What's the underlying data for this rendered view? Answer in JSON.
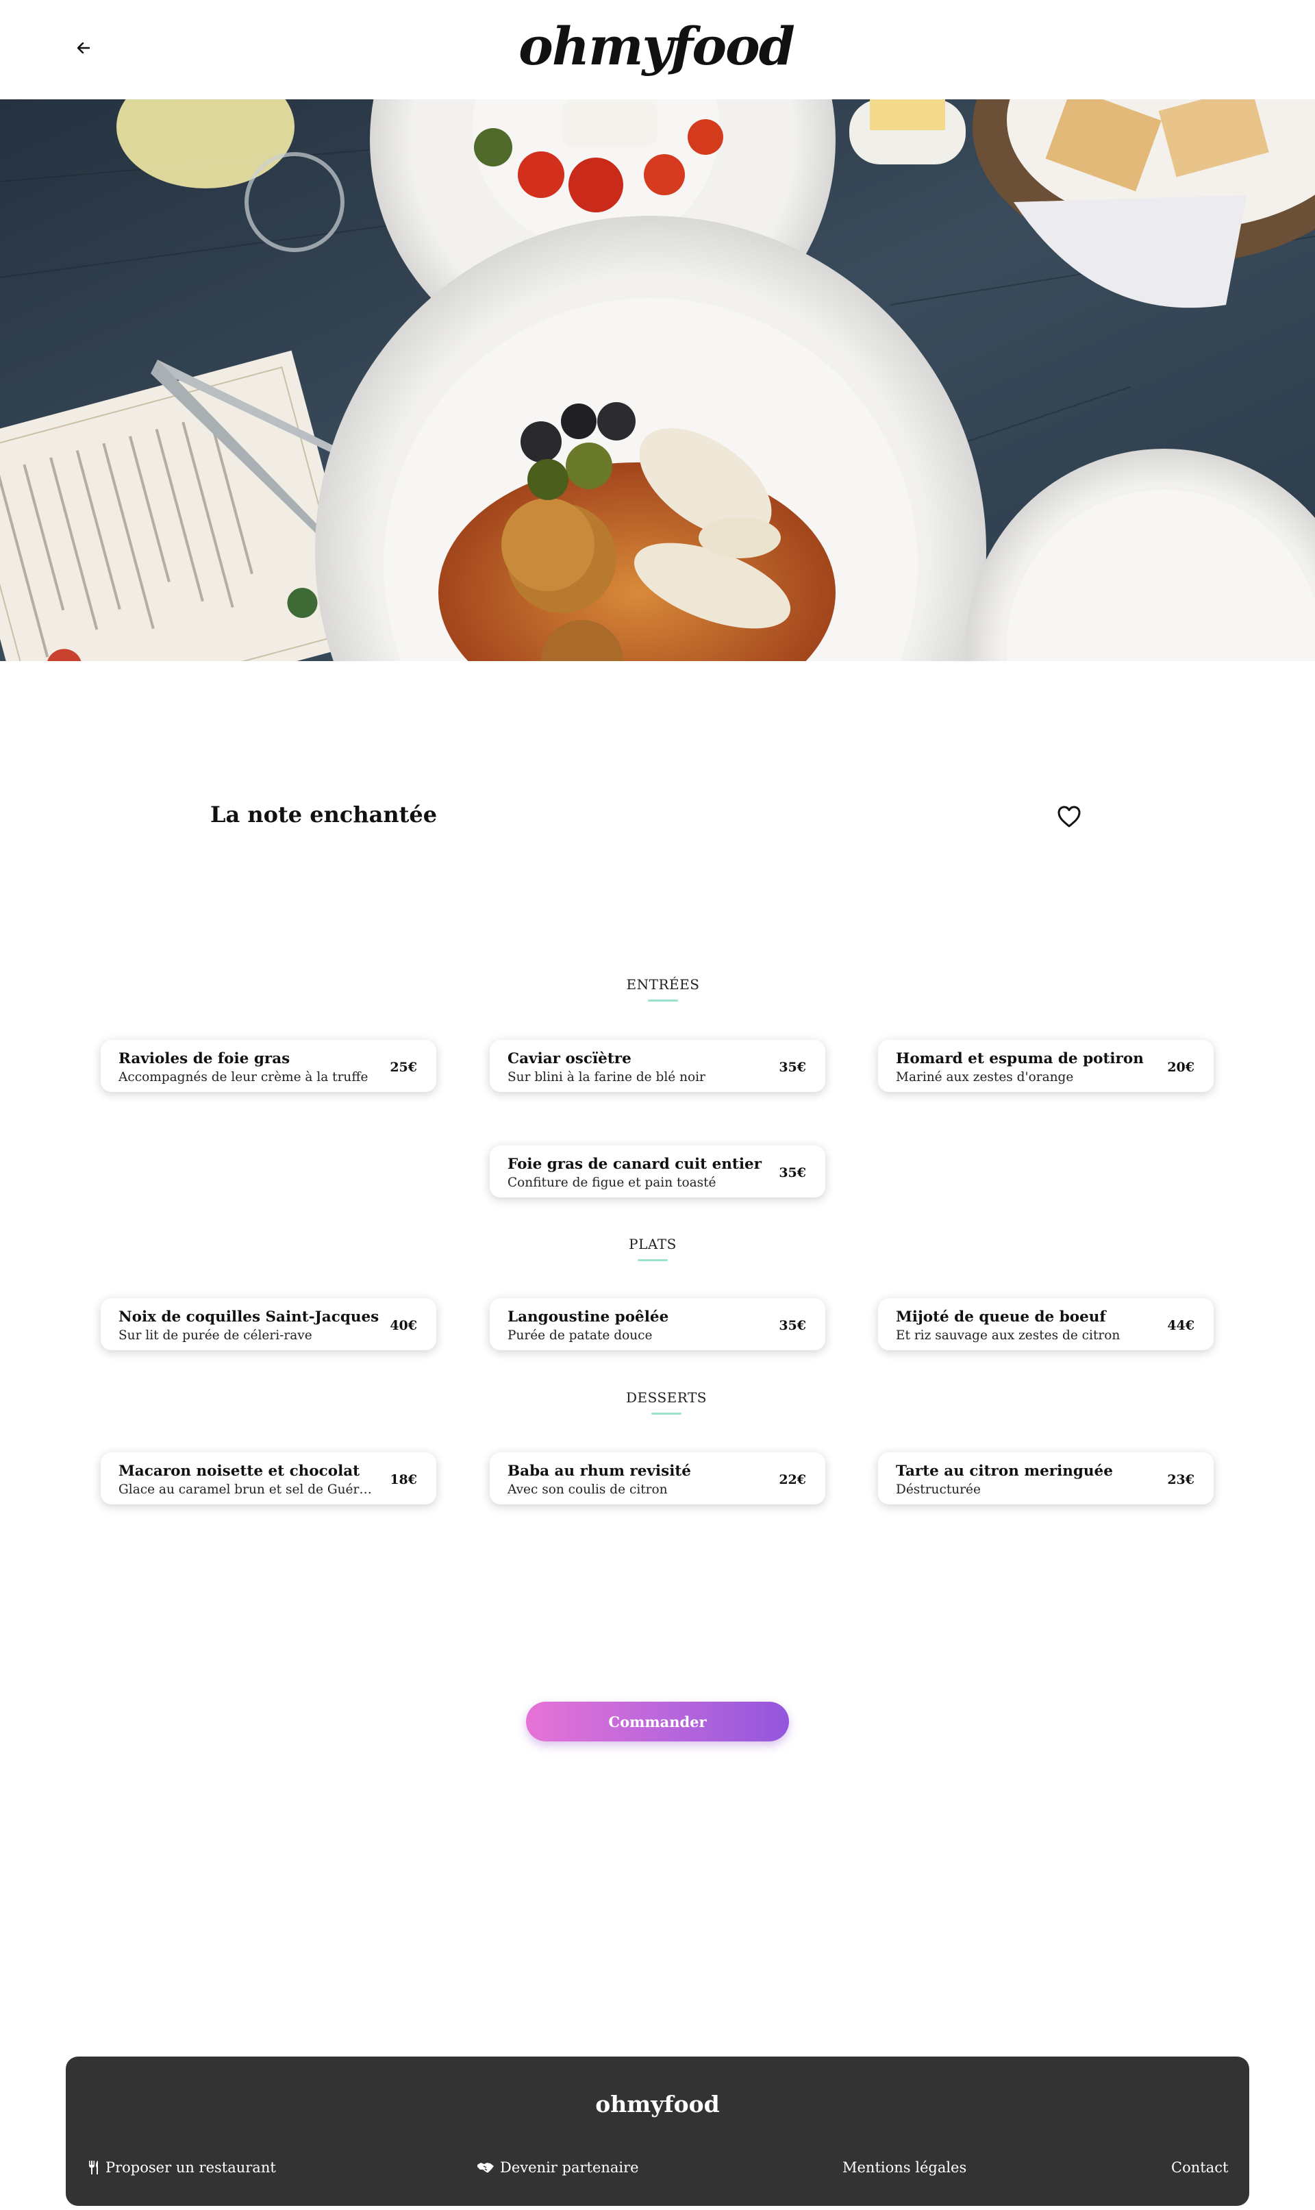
{
  "header": {
    "logo": "ohmyfood",
    "back_icon": "arrow-left-icon"
  },
  "restaurant": {
    "name": "La note enchantée",
    "favorite_icon": "heart-icon"
  },
  "sections": [
    {
      "title": "ENTRÉES",
      "items": [
        {
          "name": "Ravioles de foie gras",
          "description": "Accompagnés de leur crème à la truffe",
          "price": "25€"
        },
        {
          "name": "Caviar oscïètre",
          "description": "Sur blini à la farine de blé noir",
          "price": "35€"
        },
        {
          "name": "Homard et espuma de potiron",
          "description": "Mariné aux zestes d'orange",
          "price": "20€"
        },
        {
          "name": "Foie gras de canard cuit entier",
          "description": "Confiture de figue et pain toasté",
          "price": "35€"
        }
      ]
    },
    {
      "title": "PLATS",
      "items": [
        {
          "name": "Noix de coquilles Saint-Jacques",
          "description": "Sur lit de purée de céleri-rave",
          "price": "40€"
        },
        {
          "name": "Langoustine poêlée",
          "description": "Purée de patate douce",
          "price": "35€"
        },
        {
          "name": "Mijoté de queue de boeuf",
          "description": "Et riz sauvage aux zestes de citron",
          "price": "44€"
        }
      ]
    },
    {
      "title": "DESSERTS",
      "items": [
        {
          "name": "Macaron noisette et chocolat",
          "description": "Glace au caramel brun et sel de Guérande",
          "price": "18€"
        },
        {
          "name": "Baba au rhum revisité",
          "description": "Avec son coulis de citron",
          "price": "22€"
        },
        {
          "name": "Tarte au citron meringuée",
          "description": "Déstructurée",
          "price": "23€"
        }
      ]
    }
  ],
  "order_button": "Commander",
  "footer": {
    "brand": "ohmyfood",
    "links": [
      {
        "label": "Proposer un restaurant",
        "icon": "utensils-icon"
      },
      {
        "label": "Devenir partenaire",
        "icon": "handshake-icon"
      },
      {
        "label": "Mentions légales",
        "icon": ""
      },
      {
        "label": "Contact",
        "icon": ""
      }
    ]
  },
  "colors": {
    "accent_underline": "#99e2d0",
    "button_gradient_start": "#e673d6",
    "button_gradient_end": "#9356dc",
    "footer_bg": "#333333"
  }
}
